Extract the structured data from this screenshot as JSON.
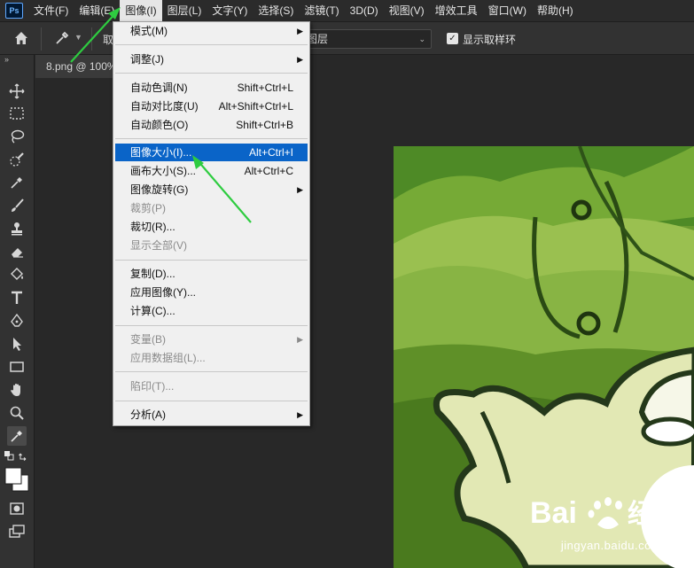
{
  "app": {
    "logo_text": "Ps"
  },
  "menubar": {
    "items": [
      {
        "label": "文件(F)"
      },
      {
        "label": "编辑(E)"
      },
      {
        "label": "图像(I)"
      },
      {
        "label": "图层(L)"
      },
      {
        "label": "文字(Y)"
      },
      {
        "label": "选择(S)"
      },
      {
        "label": "滤镜(T)"
      },
      {
        "label": "3D(D)"
      },
      {
        "label": "视图(V)"
      },
      {
        "label": "增效工具"
      },
      {
        "label": "窗口(W)"
      },
      {
        "label": "帮助(H)"
      }
    ],
    "active_index": 2
  },
  "options_bar": {
    "sample_label": "取",
    "layer_select_value": "图层",
    "show_ring_checked": true,
    "show_ring_label": "显示取样环"
  },
  "document": {
    "tab_title": "8.png @ 100%"
  },
  "image_menu": {
    "items": [
      {
        "label": "模式(M)",
        "shortcut": "",
        "submenu": true,
        "disabled": false
      },
      {
        "label": "调整(J)",
        "shortcut": "",
        "submenu": true,
        "disabled": false
      },
      {
        "label": "自动色调(N)",
        "shortcut": "Shift+Ctrl+L",
        "submenu": false,
        "disabled": false
      },
      {
        "label": "自动对比度(U)",
        "shortcut": "Alt+Shift+Ctrl+L",
        "submenu": false,
        "disabled": false
      },
      {
        "label": "自动颜色(O)",
        "shortcut": "Shift+Ctrl+B",
        "submenu": false,
        "disabled": false
      },
      {
        "label": "图像大小(I)...",
        "shortcut": "Alt+Ctrl+I",
        "submenu": false,
        "disabled": false,
        "highlighted": true
      },
      {
        "label": "画布大小(S)...",
        "shortcut": "Alt+Ctrl+C",
        "submenu": false,
        "disabled": false
      },
      {
        "label": "图像旋转(G)",
        "shortcut": "",
        "submenu": true,
        "disabled": false
      },
      {
        "label": "裁剪(P)",
        "shortcut": "",
        "submenu": false,
        "disabled": true
      },
      {
        "label": "裁切(R)...",
        "shortcut": "",
        "submenu": false,
        "disabled": false
      },
      {
        "label": "显示全部(V)",
        "shortcut": "",
        "submenu": false,
        "disabled": true
      },
      {
        "label": "复制(D)...",
        "shortcut": "",
        "submenu": false,
        "disabled": false
      },
      {
        "label": "应用图像(Y)...",
        "shortcut": "",
        "submenu": false,
        "disabled": false
      },
      {
        "label": "计算(C)...",
        "shortcut": "",
        "submenu": false,
        "disabled": false
      },
      {
        "label": "变量(B)",
        "shortcut": "",
        "submenu": true,
        "disabled": true
      },
      {
        "label": "应用数据组(L)...",
        "shortcut": "",
        "submenu": false,
        "disabled": true
      },
      {
        "label": "陷印(T)...",
        "shortcut": "",
        "submenu": false,
        "disabled": true
      },
      {
        "label": "分析(A)",
        "shortcut": "",
        "submenu": true,
        "disabled": false
      }
    ]
  },
  "watermark": {
    "brand": "Bai 经验",
    "url": "jingyan.baidu.com"
  },
  "colors": {
    "menu_highlight": "#0a64c8",
    "annotation_arrow": "#2ecc40",
    "canvas_bg": "#282828"
  },
  "icons": {
    "toolbar": [
      "move-icon",
      "marquee-icon",
      "lasso-icon",
      "quick-select-icon",
      "eyedropper-icon",
      "brush-icon",
      "stamp-icon",
      "eraser-icon",
      "paint-bucket-icon",
      "type-icon",
      "pen-icon",
      "path-select-icon",
      "rectangle-icon",
      "hand-icon",
      "zoom-icon",
      "color-sampler-icon",
      "swap-colors-icon",
      "foreground-background-icon",
      "quick-mask-icon",
      "screen-mode-icon"
    ]
  }
}
